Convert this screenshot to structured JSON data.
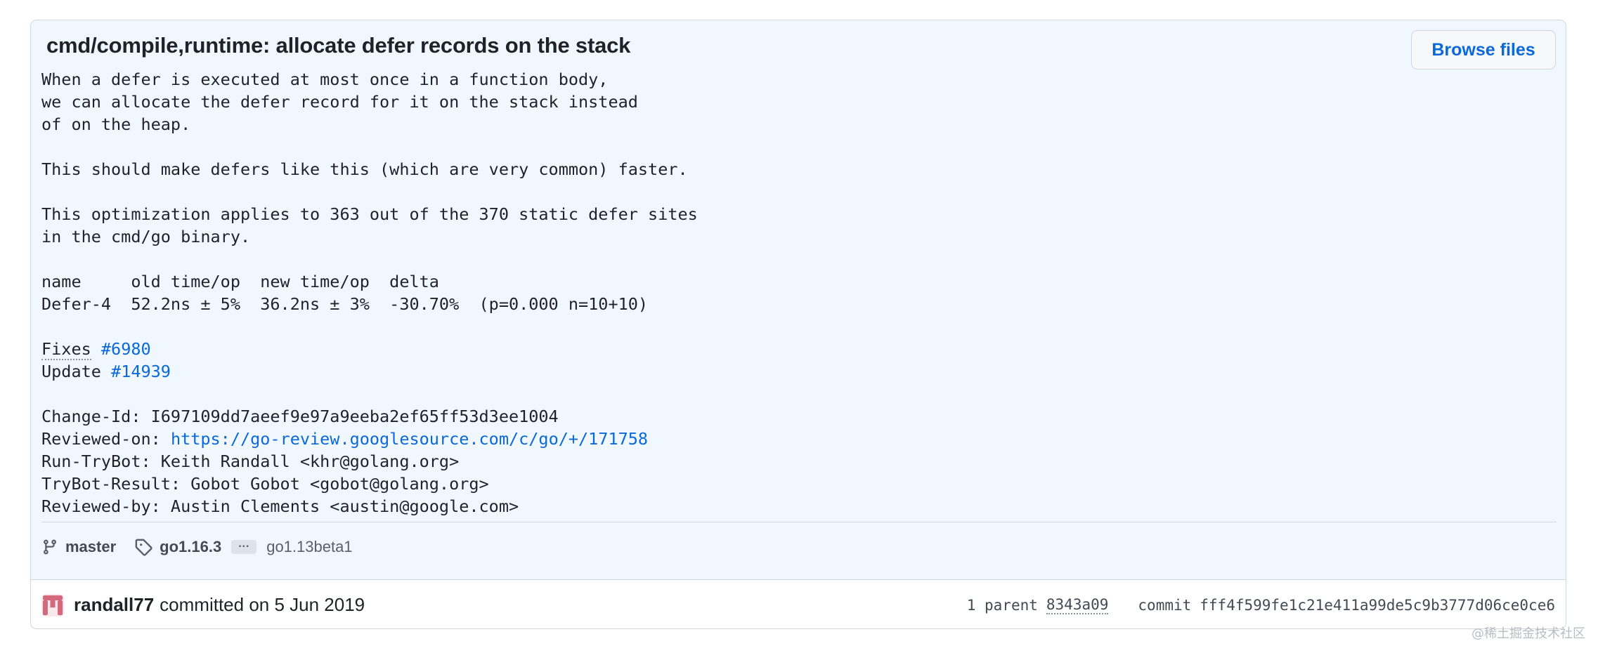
{
  "commit": {
    "title": "cmd/compile,runtime: allocate defer records on the stack",
    "browse_files_label": "Browse files",
    "message": {
      "intro": [
        "When a defer is executed at most once in a function body,",
        "we can allocate the defer record for it on the stack instead",
        "of on the heap."
      ],
      "para2": "This should make defers like this (which are very common) faster.",
      "para3": [
        "This optimization applies to 363 out of the 370 static defer sites",
        "in the cmd/go binary."
      ],
      "bench_header": "name     old time/op  new time/op  delta",
      "bench_row": "Defer-4  52.2ns ± 5%  36.2ns ± 3%  -30.70%  (p=0.000 n=10+10)",
      "fixes_keyword": "Fixes",
      "fixes_issue": "#6980",
      "update_keyword": "Update",
      "update_issue": "#14939",
      "change_id": "Change-Id: I697109dd7aeef9e97a9eeba2ef65ff53d3ee1004",
      "reviewed_on_label": "Reviewed-on: ",
      "reviewed_on_url": "https://go-review.googlesource.com/c/go/+/171758",
      "run_trybot": "Run-TryBot: Keith Randall <khr@golang.org>",
      "trybot_result": "TryBot-Result: Gobot Gobot <gobot@golang.org>",
      "reviewed_by": "Reviewed-by: Austin Clements <austin@google.com>"
    },
    "branch": "master",
    "tag_first": "go1.16.3",
    "tag_ellipsis": "···",
    "tag_last": "go1.13beta1",
    "author": "randall77",
    "committed_text": "committed on 5 Jun 2019",
    "parent_label": "1 parent",
    "parent_hash": "8343a09",
    "commit_label": "commit",
    "commit_hash": "fff4f599fe1c21e411a99de5c9b3777d06ce0ce6"
  },
  "watermark": "@稀土掘金技术社区",
  "colors": {
    "link": "#0969da",
    "header_bg": "#f1f7ff",
    "border": "#d0d7de",
    "avatar": "#d4697e"
  },
  "icons": {
    "branch": "git-branch-icon",
    "tag": "tag-icon",
    "avatar": "identicon-avatar"
  }
}
